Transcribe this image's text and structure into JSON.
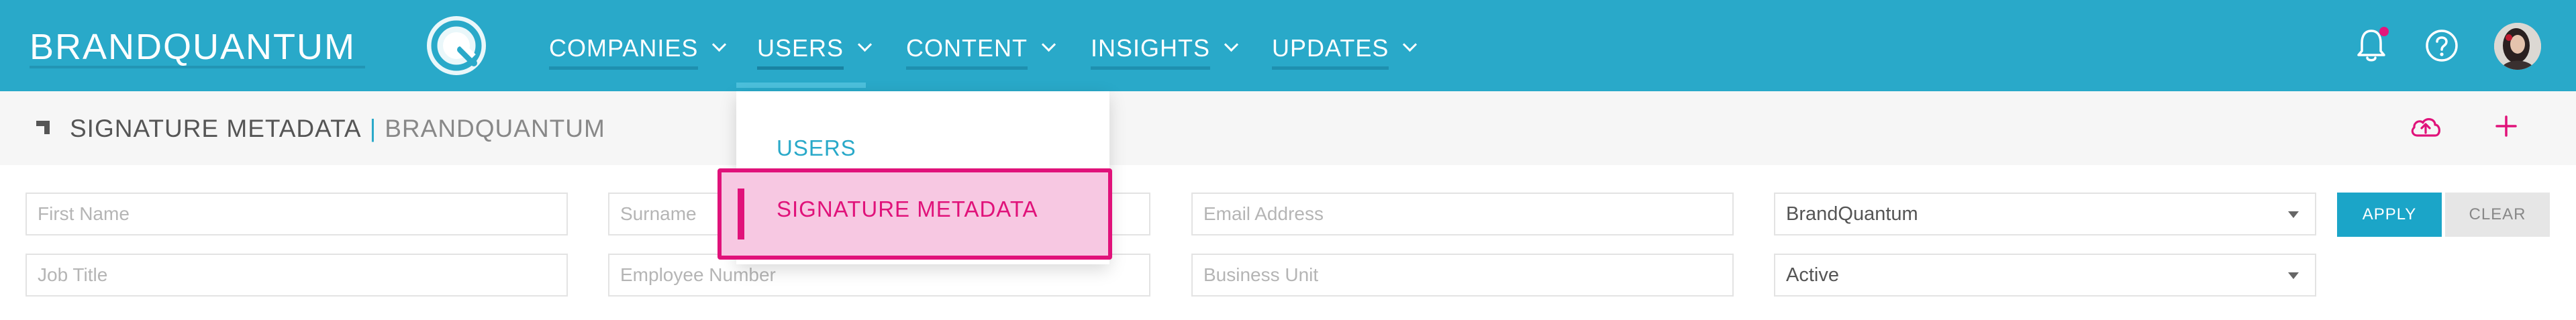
{
  "brand": {
    "name": "BRANDQUANTUM"
  },
  "nav": {
    "items": [
      {
        "label": "COMPANIES"
      },
      {
        "label": "USERS"
      },
      {
        "label": "CONTENT"
      },
      {
        "label": "INSIGHTS"
      },
      {
        "label": "UPDATES"
      }
    ],
    "active": "USERS"
  },
  "header_icons": [
    "bell-icon",
    "help-icon",
    "avatar"
  ],
  "page": {
    "title": "SIGNATURE METADATA",
    "separator": "|",
    "org": "BRANDQUANTUM"
  },
  "actions": [
    "upload-cloud-icon",
    "plus-icon"
  ],
  "filters": {
    "first_name": {
      "placeholder": "First Name",
      "value": ""
    },
    "surname": {
      "placeholder": "Surname",
      "value": ""
    },
    "email": {
      "placeholder": "Email Address",
      "value": ""
    },
    "company": {
      "selected": "BrandQuantum"
    },
    "job_title": {
      "placeholder": "Job Title",
      "value": ""
    },
    "employee_number": {
      "placeholder": "Employee Number",
      "value": ""
    },
    "business_unit": {
      "placeholder": "Business Unit",
      "value": ""
    },
    "status": {
      "selected": "Active"
    },
    "apply_label": "APPLY",
    "clear_label": "CLEAR"
  },
  "users_menu": {
    "items": [
      {
        "label": "USERS"
      },
      {
        "label": "SIGNATURE METADATA",
        "highlighted": true
      }
    ]
  },
  "colors": {
    "topbar": "#29a9c9",
    "accent": "#e0127a",
    "highlight_bg": "#f7c8e2",
    "apply_button": "#1ba5c8"
  }
}
